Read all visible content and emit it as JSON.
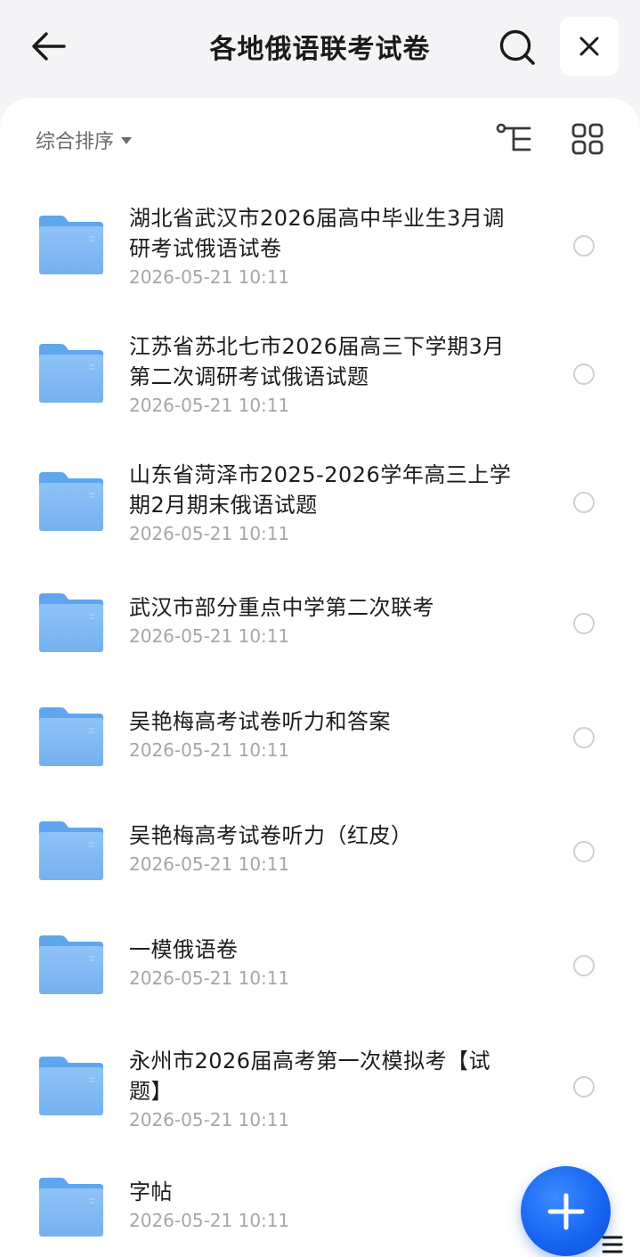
{
  "header": {
    "title": "各地俄语联考试卷",
    "back_icon": "arrow-left-icon",
    "search_icon": "search-icon",
    "close_icon": "close-icon"
  },
  "toolbar": {
    "sort_label": "综合排序",
    "tree_icon": "tree-view-icon",
    "grid_icon": "grid-view-icon"
  },
  "items": [
    {
      "name": "湖北省武汉市2026届高中毕业生3月调研考试俄语试卷",
      "date": "2026-05-21 10:11"
    },
    {
      "name": "江苏省苏北七市2026届高三下学期3月第二次调研考试俄语试题",
      "date": "2026-05-21 10:11"
    },
    {
      "name": "山东省菏泽市2025-2026学年高三上学期2月期末俄语试题",
      "date": "2026-05-21 10:11"
    },
    {
      "name": "武汉市部分重点中学第二次联考",
      "date": "2026-05-21 10:11"
    },
    {
      "name": "吴艳梅高考试卷听力和答案",
      "date": "2026-05-21 10:11"
    },
    {
      "name": "吴艳梅高考试卷听力（红皮）",
      "date": "2026-05-21 10:11"
    },
    {
      "name": "一模俄语卷",
      "date": "2026-05-21 10:11"
    },
    {
      "name": "永州市2026届高考第一次模拟考【试题】",
      "date": "2026-05-21 10:11"
    },
    {
      "name": "字帖",
      "date": "2026-05-21 10:11"
    }
  ],
  "fab": {
    "icon": "plus-icon"
  },
  "colors": {
    "accent": "#1663f0",
    "folder": "#7fbaf3",
    "folder_dark": "#5ea6ef"
  }
}
